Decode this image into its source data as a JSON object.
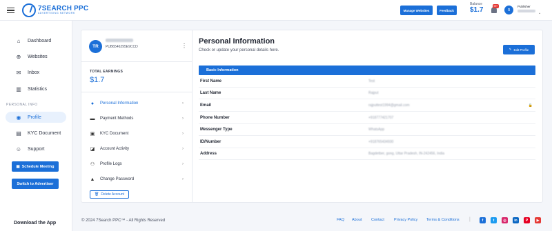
{
  "header": {
    "logo_title": "7SEARCH PPC",
    "logo_subtitle": "ADVERTISING NETWORK",
    "manage_websites": "Manage Websites",
    "feedback": "Feedback",
    "balance_label": "Balance",
    "balance_value": "$1.7",
    "notification_count": "99+",
    "avatar_initial": "R",
    "role_label": "Publisher"
  },
  "sidebar": {
    "items": [
      {
        "label": "Dashboard",
        "icon": "home-icon"
      },
      {
        "label": "Websites",
        "icon": "globe-icon"
      },
      {
        "label": "Inbox",
        "icon": "inbox-icon"
      },
      {
        "label": "Statistics",
        "icon": "statistics-icon"
      }
    ],
    "section_label": "PERSONAL INFO",
    "personal_items": [
      {
        "label": "Profile",
        "icon": "user-circle-icon",
        "active": true
      },
      {
        "label": "KYC Document",
        "icon": "document-icon"
      },
      {
        "label": "Support",
        "icon": "support-icon"
      }
    ],
    "schedule_meeting": "Schedule Meeting",
    "switch_advertiser": "Switch to Advertiser",
    "download_app": "Download the App"
  },
  "profile_card": {
    "avatar_initials": "TR",
    "user_id": "PUB6546295E9CCD",
    "total_earnings_label": "TOTAL EARNINGS",
    "total_earnings_value": "$1.7",
    "menu": [
      {
        "label": "Personal Information",
        "icon": "person-icon",
        "active": true
      },
      {
        "label": "Payment Methods",
        "icon": "card-icon"
      },
      {
        "label": "KYC Document",
        "icon": "id-card-icon"
      },
      {
        "label": "Account Activity",
        "icon": "activity-icon"
      },
      {
        "label": "Profile Logs",
        "icon": "users-icon"
      },
      {
        "label": "Change Password",
        "icon": "lock-icon"
      }
    ],
    "delete_account": "Delete Account"
  },
  "personal_info": {
    "title": "Personal Information",
    "subtitle": "Check or update your personal details here.",
    "edit_profile": "Edit Profile",
    "section_title": "Basic Information",
    "fields": [
      {
        "label": "First Name",
        "value": "Test"
      },
      {
        "label": "Last Name",
        "value": "Rajput"
      },
      {
        "label": "Email",
        "value": "rajputtest1994@gmail.com"
      },
      {
        "label": "Phone Number",
        "value": "+918777421707"
      },
      {
        "label": "Messenger Type",
        "value": "WhatsApp"
      },
      {
        "label": "ID/Number",
        "value": "+918765434930"
      },
      {
        "label": "Address",
        "value": "Bagdetber, gong, Uttar Pradesh, IN-242456, India"
      }
    ]
  },
  "footer": {
    "copyright": "© 2024 7Search PPC™ - All Rights Reserved",
    "links": [
      "FAQ",
      "About",
      "Contact",
      "Privacy Policy",
      "Terms & Conditions"
    ],
    "social": [
      {
        "icon": "facebook-icon",
        "glyph": "f",
        "color": "#1b6fd8"
      },
      {
        "icon": "twitter-icon",
        "glyph": "t",
        "color": "#1b9bf0"
      },
      {
        "icon": "instagram-icon",
        "glyph": "◎",
        "color": "#d8286c"
      },
      {
        "icon": "linkedin-icon",
        "glyph": "in",
        "color": "#0a66c2"
      },
      {
        "icon": "pinterest-icon",
        "glyph": "P",
        "color": "#e60023"
      },
      {
        "icon": "youtube-icon",
        "glyph": "▶",
        "color": "#e53935"
      }
    ]
  }
}
